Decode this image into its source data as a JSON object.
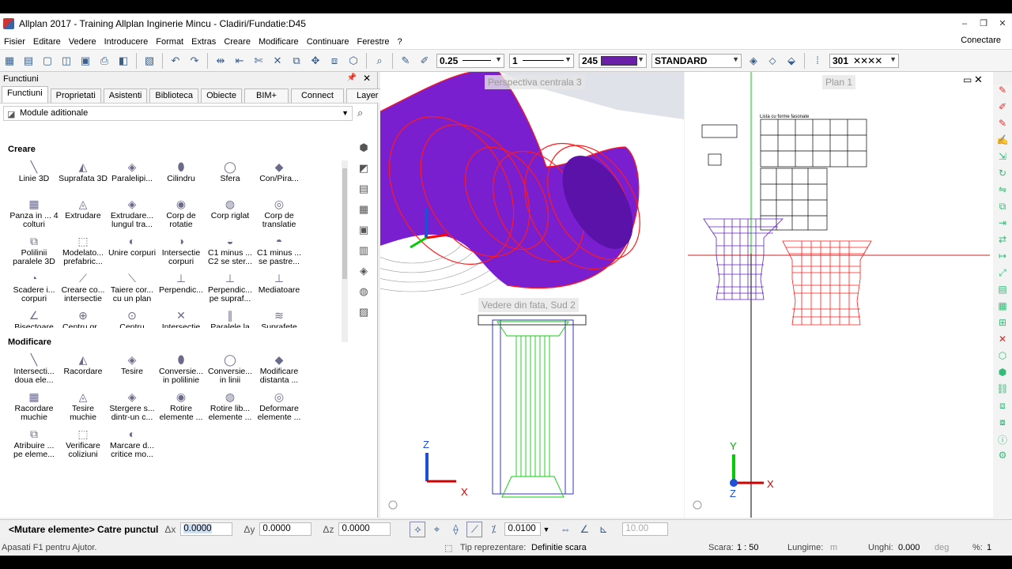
{
  "window": {
    "title": "Allplan 2017 - Training Allplan Inginerie Mincu - Cladiri/Fundatie:D45",
    "controls": [
      "–",
      "❐",
      "✕"
    ]
  },
  "menu": {
    "items": [
      "Fisier",
      "Editare",
      "Vedere",
      "Introducere",
      "Format",
      "Extras",
      "Creare",
      "Modificare",
      "Continuare",
      "Ferestre",
      "?"
    ],
    "right": "Conectare"
  },
  "toolbar": {
    "pen_thickness": "0.25",
    "line_type": "1",
    "color_number": "245",
    "layer": "STANDARD",
    "pattern_number": "301"
  },
  "panel": {
    "title": "Functiuni",
    "tabs": [
      "Functiuni",
      "Proprietati",
      "Asistenti",
      "Biblioteca",
      "Obiecte",
      "BIM+",
      "Connect",
      "Layer"
    ],
    "module": "Module aditionale",
    "sections": [
      {
        "title": "Creare",
        "items": [
          {
            "label": "Linie 3D",
            "icon": "line-3d-icon"
          },
          {
            "label": "Suprafata 3D",
            "icon": "surface-3d-icon"
          },
          {
            "label": "Paralelipi...",
            "icon": "box-icon"
          },
          {
            "label": "Cilindru",
            "icon": "cylinder-icon"
          },
          {
            "label": "Sfera",
            "icon": "sphere-icon"
          },
          {
            "label": "Con/Pira...",
            "icon": "cone-icon"
          },
          {
            "label": "Panza in ... 4 colturi",
            "icon": "patch-icon"
          },
          {
            "label": "Extrudare",
            "icon": "extrude-icon"
          },
          {
            "label": "Extrudare... lungul tra...",
            "icon": "sweep-icon"
          },
          {
            "label": "Corp de rotatie",
            "icon": "revolve-icon"
          },
          {
            "label": "Corp riglat",
            "icon": "ruled-icon"
          },
          {
            "label": "Corp de translatie",
            "icon": "translate-icon"
          },
          {
            "label": "Polilinii paralele 3D",
            "icon": "polyline-icon"
          },
          {
            "label": "Modelato... prefabric...",
            "icon": "precast-icon"
          },
          {
            "label": "Unire corpuri",
            "icon": "union-icon"
          },
          {
            "label": "Intersectie corpuri",
            "icon": "intersect-icon"
          },
          {
            "label": "C1 minus ... C2 se ster...",
            "icon": "subtract-icon"
          },
          {
            "label": "C1 minus ... se pastre...",
            "icon": "subtract-keep-icon"
          },
          {
            "label": "Scadere i... corpuri",
            "icon": "subtract-bodies-icon"
          },
          {
            "label": "Creare co... intersectie",
            "icon": "intersection-edge-icon"
          },
          {
            "label": "Taiere cor... cu un plan",
            "icon": "cut-plane-icon"
          },
          {
            "label": "Perpendic...",
            "icon": "perpendicular-icon"
          },
          {
            "label": "Perpendic... pe supraf...",
            "icon": "perpendicular-surface-icon"
          },
          {
            "label": "Mediatoare",
            "icon": "bisector-icon"
          },
          {
            "label": "Bisectoare",
            "icon": "angle-bisector-icon"
          },
          {
            "label": "Centru gr...",
            "icon": "centroid-icon"
          },
          {
            "label": "Centru",
            "icon": "center-icon"
          },
          {
            "label": "Intersectie",
            "icon": "intersection-icon"
          },
          {
            "label": "Paralele la",
            "icon": "parallel-icon"
          },
          {
            "label": "Suprafete",
            "icon": "surfaces-icon"
          }
        ]
      },
      {
        "title": "Modificare",
        "items": [
          {
            "label": "Intersecti... doua ele...",
            "icon": "intersect-two-icon"
          },
          {
            "label": "Racordare",
            "icon": "fillet-icon"
          },
          {
            "label": "Tesire",
            "icon": "chamfer-icon"
          },
          {
            "label": "Conversie... in polilinie",
            "icon": "convert-polyline-icon"
          },
          {
            "label": "Conversie... in linii",
            "icon": "convert-lines-icon"
          },
          {
            "label": "Modificare distanta ...",
            "icon": "modify-distance-icon"
          },
          {
            "label": "Racordare muchie",
            "icon": "fillet-edge-icon"
          },
          {
            "label": "Tesire muchie",
            "icon": "chamfer-edge-icon"
          },
          {
            "label": "Stergere s... dintr-un c...",
            "icon": "delete-surface-icon"
          },
          {
            "label": "Rotire elemente ...",
            "icon": "rotate-icon"
          },
          {
            "label": "Rotire lib... elemente ...",
            "icon": "free-rotate-icon"
          },
          {
            "label": "Deformare elemente ...",
            "icon": "deform-icon"
          },
          {
            "label": "Atribuire ... pe eleme...",
            "icon": "assign-icon"
          },
          {
            "label": "Verificare coliziuni",
            "icon": "collision-icon"
          },
          {
            "label": "Marcare d... critice mo...",
            "icon": "mark-critical-icon"
          }
        ]
      }
    ]
  },
  "viewports": {
    "perspective": "Perspectiva centrala 3",
    "front": "Vedere din fata, Sud 2",
    "plan": "Plan 1",
    "list_title": "Lista cu forme fasonate"
  },
  "axes": {
    "z": "Z",
    "y": "Y",
    "x": "X"
  },
  "command": {
    "text": "<Mutare elemente> Catre punctul",
    "dx_label": "Δx",
    "dx": "0.0000",
    "dy_label": "Δy",
    "dy": "0.0000",
    "dz_label": "Δz",
    "dz": "0.0000",
    "tolerance": "0.0100",
    "step": "10.00"
  },
  "status": {
    "help": "Apasati F1 pentru Ajutor.",
    "repr_label": "Tip reprezentare:",
    "repr_value": "Definitie scara",
    "scale_label": "Scara:",
    "scale_value": "1 : 50",
    "length_label": "Lungime:",
    "length_unit": "m",
    "angle_label": "Unghi:",
    "angle_value": "0.000",
    "angle_unit": "deg",
    "percent_label": "%:",
    "percent_value": "1"
  },
  "colors": {
    "accent_purple": "#8a2be2",
    "wire_red": "#ff0000",
    "wire_green": "#00cc00",
    "axis_blue": "#1e4fd8"
  }
}
